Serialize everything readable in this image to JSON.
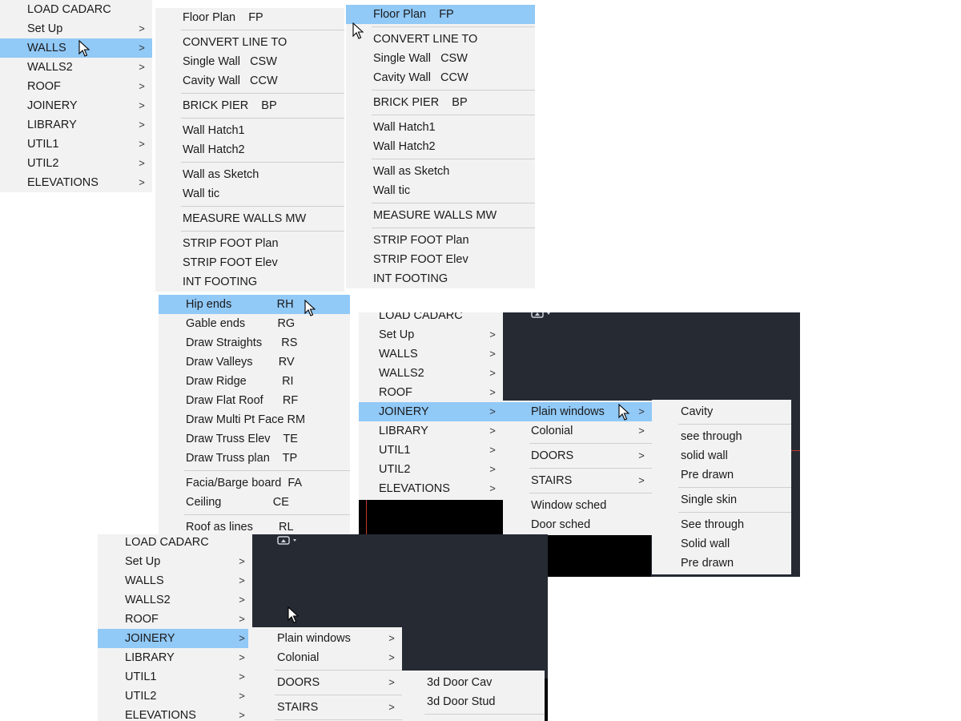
{
  "main_menu": {
    "items": [
      {
        "label": "LOAD CADARC",
        "submenu": false
      },
      {
        "label": "Set Up",
        "submenu": true
      },
      {
        "label": "WALLS",
        "submenu": true
      },
      {
        "label": "WALLS2",
        "submenu": true
      },
      {
        "label": "ROOF",
        "submenu": true
      },
      {
        "label": "JOINERY",
        "submenu": true
      },
      {
        "label": "LIBRARY",
        "submenu": true
      },
      {
        "label": "UTIL1",
        "submenu": true
      },
      {
        "label": "UTIL2",
        "submenu": true
      },
      {
        "label": "ELEVATIONS",
        "submenu": true
      }
    ],
    "arrow_glyph": ">"
  },
  "walls_menu": {
    "items": [
      "Floor Plan    FP",
      "CONVERT LINE TO",
      "Single Wall   CSW",
      "Cavity Wall   CCW",
      "BRICK PIER    BP",
      "Wall Hatch1",
      "Wall Hatch2",
      "Wall as Sketch",
      "Wall tic",
      "MEASURE WALLS MW",
      "STRIP FOOT Plan",
      "STRIP FOOT Elev",
      "INT FOOTING"
    ]
  },
  "roof_menu": {
    "items": [
      "Hip ends              RH",
      "Gable ends          RG",
      "Draw Straights      RS",
      "Draw Valleys        RV",
      "Draw Ridge           RI",
      "Draw Flat Roof      RF",
      "Draw Multi Pt Face RM",
      "Draw Truss Elev    TE",
      "Draw Truss plan    TP",
      "Facia/Barge board  FA",
      "Ceiling                CE",
      "Roof as lines        RL"
    ]
  },
  "joinery_menu": {
    "items": [
      {
        "label": "Plain windows",
        "submenu": true
      },
      {
        "label": "Colonial",
        "submenu": true
      },
      {
        "label": "DOORS",
        "submenu": true
      },
      {
        "label": "STAIRS",
        "submenu": true
      },
      {
        "label": "Window sched",
        "submenu": false
      },
      {
        "label": "Door sched",
        "submenu": false
      }
    ]
  },
  "plain_windows_menu": {
    "items": [
      "Cavity",
      "see through",
      "solid wall",
      "Pre drawn",
      "Single skin",
      "See through",
      "Solid wall",
      "Pre drawn"
    ]
  },
  "doors_menu": {
    "items": [
      "3d Door Cav",
      "3d Door Stud"
    ]
  },
  "colors": {
    "menu_bg": "#f2f2f2",
    "highlight": "#91c9f7",
    "separator": "#cfcfcf",
    "cad_background": "#252a33"
  }
}
